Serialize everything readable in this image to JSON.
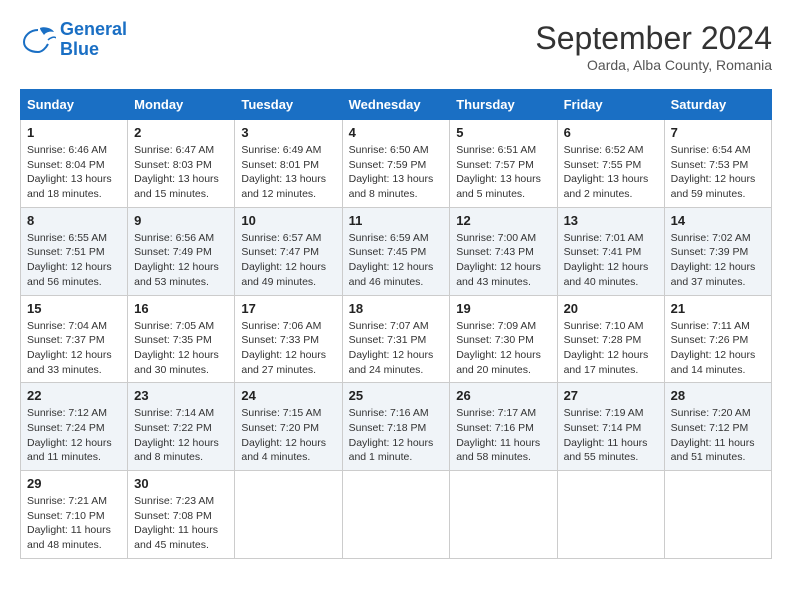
{
  "header": {
    "logo_general": "General",
    "logo_blue": "Blue",
    "month_title": "September 2024",
    "location": "Oarda, Alba County, Romania"
  },
  "columns": [
    "Sunday",
    "Monday",
    "Tuesday",
    "Wednesday",
    "Thursday",
    "Friday",
    "Saturday"
  ],
  "weeks": [
    [
      {
        "day": "1",
        "sunrise": "Sunrise: 6:46 AM",
        "sunset": "Sunset: 8:04 PM",
        "daylight": "Daylight: 13 hours and 18 minutes."
      },
      {
        "day": "2",
        "sunrise": "Sunrise: 6:47 AM",
        "sunset": "Sunset: 8:03 PM",
        "daylight": "Daylight: 13 hours and 15 minutes."
      },
      {
        "day": "3",
        "sunrise": "Sunrise: 6:49 AM",
        "sunset": "Sunset: 8:01 PM",
        "daylight": "Daylight: 13 hours and 12 minutes."
      },
      {
        "day": "4",
        "sunrise": "Sunrise: 6:50 AM",
        "sunset": "Sunset: 7:59 PM",
        "daylight": "Daylight: 13 hours and 8 minutes."
      },
      {
        "day": "5",
        "sunrise": "Sunrise: 6:51 AM",
        "sunset": "Sunset: 7:57 PM",
        "daylight": "Daylight: 13 hours and 5 minutes."
      },
      {
        "day": "6",
        "sunrise": "Sunrise: 6:52 AM",
        "sunset": "Sunset: 7:55 PM",
        "daylight": "Daylight: 13 hours and 2 minutes."
      },
      {
        "day": "7",
        "sunrise": "Sunrise: 6:54 AM",
        "sunset": "Sunset: 7:53 PM",
        "daylight": "Daylight: 12 hours and 59 minutes."
      }
    ],
    [
      {
        "day": "8",
        "sunrise": "Sunrise: 6:55 AM",
        "sunset": "Sunset: 7:51 PM",
        "daylight": "Daylight: 12 hours and 56 minutes."
      },
      {
        "day": "9",
        "sunrise": "Sunrise: 6:56 AM",
        "sunset": "Sunset: 7:49 PM",
        "daylight": "Daylight: 12 hours and 53 minutes."
      },
      {
        "day": "10",
        "sunrise": "Sunrise: 6:57 AM",
        "sunset": "Sunset: 7:47 PM",
        "daylight": "Daylight: 12 hours and 49 minutes."
      },
      {
        "day": "11",
        "sunrise": "Sunrise: 6:59 AM",
        "sunset": "Sunset: 7:45 PM",
        "daylight": "Daylight: 12 hours and 46 minutes."
      },
      {
        "day": "12",
        "sunrise": "Sunrise: 7:00 AM",
        "sunset": "Sunset: 7:43 PM",
        "daylight": "Daylight: 12 hours and 43 minutes."
      },
      {
        "day": "13",
        "sunrise": "Sunrise: 7:01 AM",
        "sunset": "Sunset: 7:41 PM",
        "daylight": "Daylight: 12 hours and 40 minutes."
      },
      {
        "day": "14",
        "sunrise": "Sunrise: 7:02 AM",
        "sunset": "Sunset: 7:39 PM",
        "daylight": "Daylight: 12 hours and 37 minutes."
      }
    ],
    [
      {
        "day": "15",
        "sunrise": "Sunrise: 7:04 AM",
        "sunset": "Sunset: 7:37 PM",
        "daylight": "Daylight: 12 hours and 33 minutes."
      },
      {
        "day": "16",
        "sunrise": "Sunrise: 7:05 AM",
        "sunset": "Sunset: 7:35 PM",
        "daylight": "Daylight: 12 hours and 30 minutes."
      },
      {
        "day": "17",
        "sunrise": "Sunrise: 7:06 AM",
        "sunset": "Sunset: 7:33 PM",
        "daylight": "Daylight: 12 hours and 27 minutes."
      },
      {
        "day": "18",
        "sunrise": "Sunrise: 7:07 AM",
        "sunset": "Sunset: 7:31 PM",
        "daylight": "Daylight: 12 hours and 24 minutes."
      },
      {
        "day": "19",
        "sunrise": "Sunrise: 7:09 AM",
        "sunset": "Sunset: 7:30 PM",
        "daylight": "Daylight: 12 hours and 20 minutes."
      },
      {
        "day": "20",
        "sunrise": "Sunrise: 7:10 AM",
        "sunset": "Sunset: 7:28 PM",
        "daylight": "Daylight: 12 hours and 17 minutes."
      },
      {
        "day": "21",
        "sunrise": "Sunrise: 7:11 AM",
        "sunset": "Sunset: 7:26 PM",
        "daylight": "Daylight: 12 hours and 14 minutes."
      }
    ],
    [
      {
        "day": "22",
        "sunrise": "Sunrise: 7:12 AM",
        "sunset": "Sunset: 7:24 PM",
        "daylight": "Daylight: 12 hours and 11 minutes."
      },
      {
        "day": "23",
        "sunrise": "Sunrise: 7:14 AM",
        "sunset": "Sunset: 7:22 PM",
        "daylight": "Daylight: 12 hours and 8 minutes."
      },
      {
        "day": "24",
        "sunrise": "Sunrise: 7:15 AM",
        "sunset": "Sunset: 7:20 PM",
        "daylight": "Daylight: 12 hours and 4 minutes."
      },
      {
        "day": "25",
        "sunrise": "Sunrise: 7:16 AM",
        "sunset": "Sunset: 7:18 PM",
        "daylight": "Daylight: 12 hours and 1 minute."
      },
      {
        "day": "26",
        "sunrise": "Sunrise: 7:17 AM",
        "sunset": "Sunset: 7:16 PM",
        "daylight": "Daylight: 11 hours and 58 minutes."
      },
      {
        "day": "27",
        "sunrise": "Sunrise: 7:19 AM",
        "sunset": "Sunset: 7:14 PM",
        "daylight": "Daylight: 11 hours and 55 minutes."
      },
      {
        "day": "28",
        "sunrise": "Sunrise: 7:20 AM",
        "sunset": "Sunset: 7:12 PM",
        "daylight": "Daylight: 11 hours and 51 minutes."
      }
    ],
    [
      {
        "day": "29",
        "sunrise": "Sunrise: 7:21 AM",
        "sunset": "Sunset: 7:10 PM",
        "daylight": "Daylight: 11 hours and 48 minutes."
      },
      {
        "day": "30",
        "sunrise": "Sunrise: 7:23 AM",
        "sunset": "Sunset: 7:08 PM",
        "daylight": "Daylight: 11 hours and 45 minutes."
      },
      null,
      null,
      null,
      null,
      null
    ]
  ]
}
